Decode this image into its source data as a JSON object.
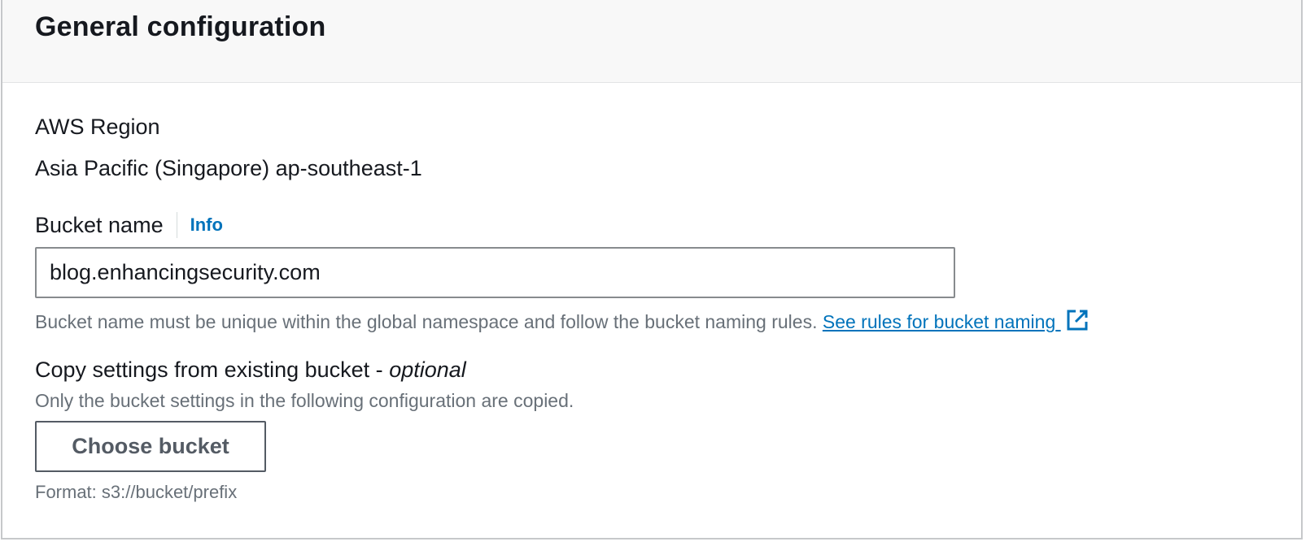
{
  "header": {
    "title": "General configuration"
  },
  "region": {
    "label": "AWS Region",
    "value": "Asia Pacific (Singapore) ap-southeast-1"
  },
  "bucket_name": {
    "label": "Bucket name",
    "info_link": "Info",
    "value": "blog.enhancingsecurity.com",
    "hint": "Bucket name must be unique within the global namespace and follow the bucket naming rules.",
    "rules_link": "See rules for bucket naming",
    "rules_link_icon": "external-link-icon"
  },
  "copy_settings": {
    "label": "Copy settings from existing bucket - ",
    "label_optional": "optional",
    "description": "Only the bucket settings in the following configuration are copied.",
    "button_label": "Choose bucket",
    "format_hint": "Format: s3://bucket/prefix"
  },
  "colors": {
    "link": "#0073bb",
    "text": "#16191f",
    "secondary_text": "#687078",
    "header_bg": "#f8f8f8"
  }
}
